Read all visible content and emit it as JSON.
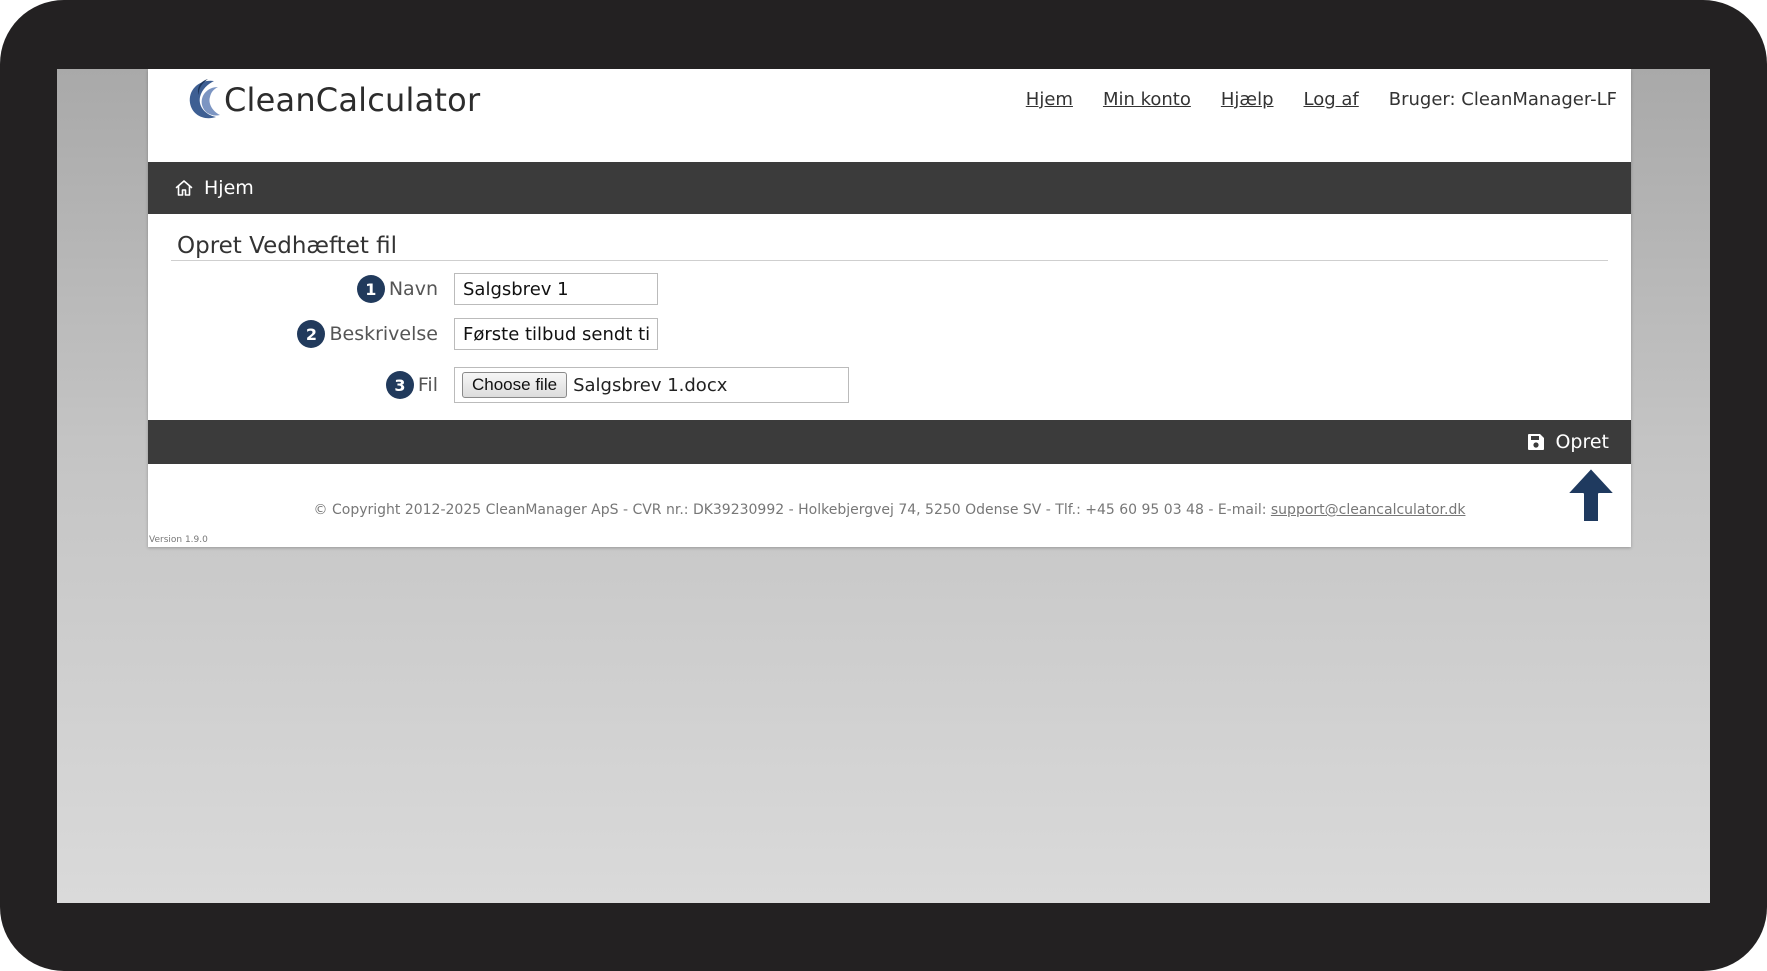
{
  "app": {
    "logo_text": "CleanCalculator",
    "brand_color": "#213a5c"
  },
  "topnav": {
    "items": [
      "Hjem",
      "Min konto",
      "Hjælp",
      "Log af"
    ],
    "user": "Bruger: CleanManager-LF"
  },
  "breadcrumb": {
    "icon": "home-icon",
    "label": "Hjem"
  },
  "form": {
    "title": "Opret Vedhæftet fil",
    "fields": {
      "navn": {
        "step": "1",
        "label": "Navn",
        "value": "Salgsbrev 1"
      },
      "beskrivelse": {
        "step": "2",
        "label": "Beskrivelse",
        "value": "Første tilbud sendt til kur"
      },
      "fil": {
        "step": "3",
        "label": "Fil",
        "button": "Choose file",
        "filename": "Salgsbrev 1.docx"
      }
    }
  },
  "actions": {
    "save_icon": "floppy-disk-icon",
    "save_label": "Opret",
    "pointer": "arrow-up-icon"
  },
  "footer": {
    "copyright": "© Copyright 2012-2025 CleanManager ApS - CVR nr.: DK39230992 - Holkebjergvej 74, 5250 Odense SV - Tlf.: +45 60 95 03 48 - E-mail: ",
    "email": "support@cleancalculator.dk",
    "version": "Version 1.9.0"
  }
}
